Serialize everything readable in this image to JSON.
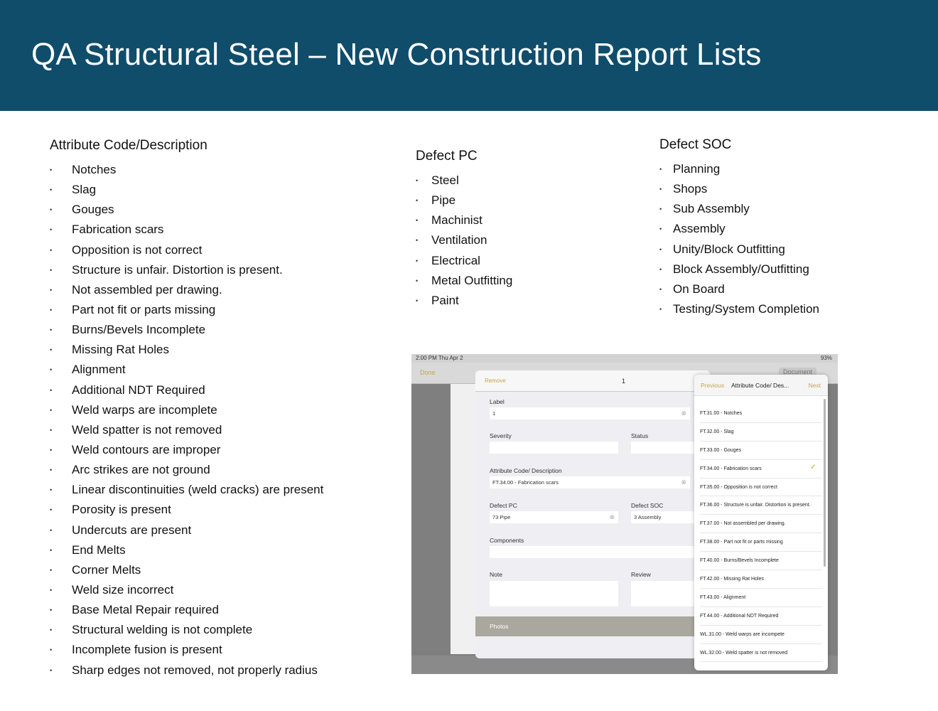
{
  "title": "QA Structural Steel – New Construction Report Lists",
  "attribute_list": {
    "heading": "Attribute Code/Description",
    "items": [
      "Notches",
      "Slag",
      "Gouges",
      "Fabrication scars",
      "Opposition is not correct",
      "Structure is unfair. Distortion is present.",
      "Not assembled per drawing.",
      "Part not fit or parts missing",
      "Burns/Bevels Incomplete",
      "Missing Rat Holes",
      "Alignment",
      "Additional NDT Required",
      "Weld warps are incomplete",
      "Weld spatter is not removed",
      "Weld contours are improper",
      "Arc strikes are not ground",
      "Linear discontinuities (weld cracks) are present",
      "Porosity is present",
      "Undercuts are present",
      "End Melts",
      "Corner Melts",
      "Weld size incorrect",
      "Base Metal Repair required",
      "Structural welding is not complete",
      "Incomplete fusion is present",
      "Sharp edges not removed, not properly radius"
    ]
  },
  "defect_pc": {
    "heading": "Defect PC",
    "items": [
      "Steel",
      "Pipe",
      "Machinist",
      "Ventilation",
      "Electrical",
      "Metal Outfitting",
      "Paint"
    ]
  },
  "defect_soc": {
    "heading": "Defect SOC",
    "items": [
      "Planning",
      "Shops",
      "Sub Assembly",
      "Assembly",
      "Unity/Block Outfitting",
      "Block Assembly/Outfitting",
      "On Board",
      "Testing/System Completion"
    ]
  },
  "bullet": "•",
  "screenshot": {
    "status_time": "2:00 PM  Thu Apr 2",
    "status_battery": "93%",
    "done_label": "Done",
    "document_label": "Document",
    "form": {
      "remove_label": "Remove",
      "number": "1",
      "label_label": "Label",
      "label_value": "1",
      "severity_label": "Severity",
      "status_label": "Status",
      "attr_label": "Attribute Code/ Description",
      "attr_value": "FT.34.00 - Fabrication scars",
      "defect_pc_label": "Defect PC",
      "defect_pc_value": "73 Pipe",
      "defect_soc_label": "Defect SOC",
      "defect_soc_value": "3 Assembly",
      "components_label": "Components",
      "note_label": "Note",
      "review_label": "Review",
      "photos_label": "Photos",
      "clear_glyph": "⊗"
    },
    "popover": {
      "previous_label": "Previous",
      "title": "Attribute Code/ Des...",
      "next_label": "Next",
      "checkmark": "✓",
      "selected_index": 3,
      "items": [
        "FT.31.00 - Notches",
        "FT.32.00 - Slag",
        "FT.33.00 - Gouges",
        "FT.34.00 - Fabrication scars",
        "FT.35.00 - Opposition is not correct",
        "FT.36.00 - Structure is unfair. Distortion is present.",
        "FT.37.00 - Not assembled per drawing.",
        "FT.38.00 - Part not fit or parts missing",
        "FT.40.00 - Burns/Bevels Incomplete",
        "FT.42.00 - Missing Rat Holes",
        "FT.43.00 - Alignment",
        "FT.44.00 - Additional NDT Required",
        "WL.31.00 - Weld warps are incompete",
        "WL.32.00 - Weld spatter is not removed"
      ]
    }
  }
}
